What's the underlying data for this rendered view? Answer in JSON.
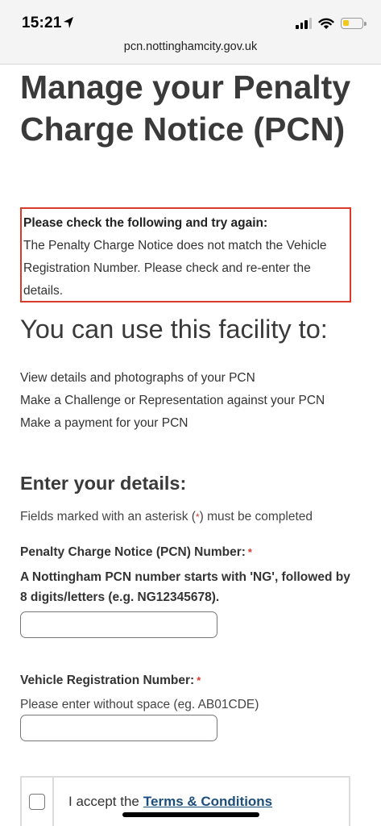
{
  "status_bar": {
    "time": "15:21",
    "location_icon": "location-arrow-icon",
    "signal_icon": "cellular-signal-icon",
    "wifi_icon": "wifi-icon",
    "battery_icon": "battery-icon",
    "battery_level": 0.3,
    "battery_color": "#f2c81b"
  },
  "browser": {
    "url": "pcn.nottinghamcity.gov.uk"
  },
  "page": {
    "title": "Manage your Penalty Charge Notice (PCN)"
  },
  "error": {
    "title": "Please check the following and try again:",
    "message": "The Penalty Charge Notice does not match the Vehicle Registration Number. Please check and re-enter the details.",
    "border_color": "#d93a2b"
  },
  "facility": {
    "heading": "You can use this facility to:",
    "items": [
      "View details and photographs of your PCN",
      "Make a Challenge or Representation against your PCN",
      "Make a payment for your PCN"
    ]
  },
  "details": {
    "heading": "Enter your details:",
    "note_before": "Fields marked with an asterisk (",
    "note_asterisk": "*",
    "note_after": ") must be completed"
  },
  "pcn_field": {
    "label": "Penalty Charge Notice (PCN) Number:",
    "required_mark": "*",
    "hint": "A Nottingham PCN number starts with 'NG', followed by 8 digits/letters (e.g. NG12345678).",
    "value": "",
    "placeholder": ""
  },
  "reg_field": {
    "label": "Vehicle Registration Number:",
    "required_mark": "*",
    "hint": "Please enter without space (eg. AB01CDE)",
    "value": "",
    "placeholder": ""
  },
  "terms": {
    "prefix": "I accept the",
    "link_label": "Terms & Conditions",
    "checked": false
  },
  "colors": {
    "accent_red": "#d93a2b",
    "link_blue": "#1c4e7c"
  }
}
